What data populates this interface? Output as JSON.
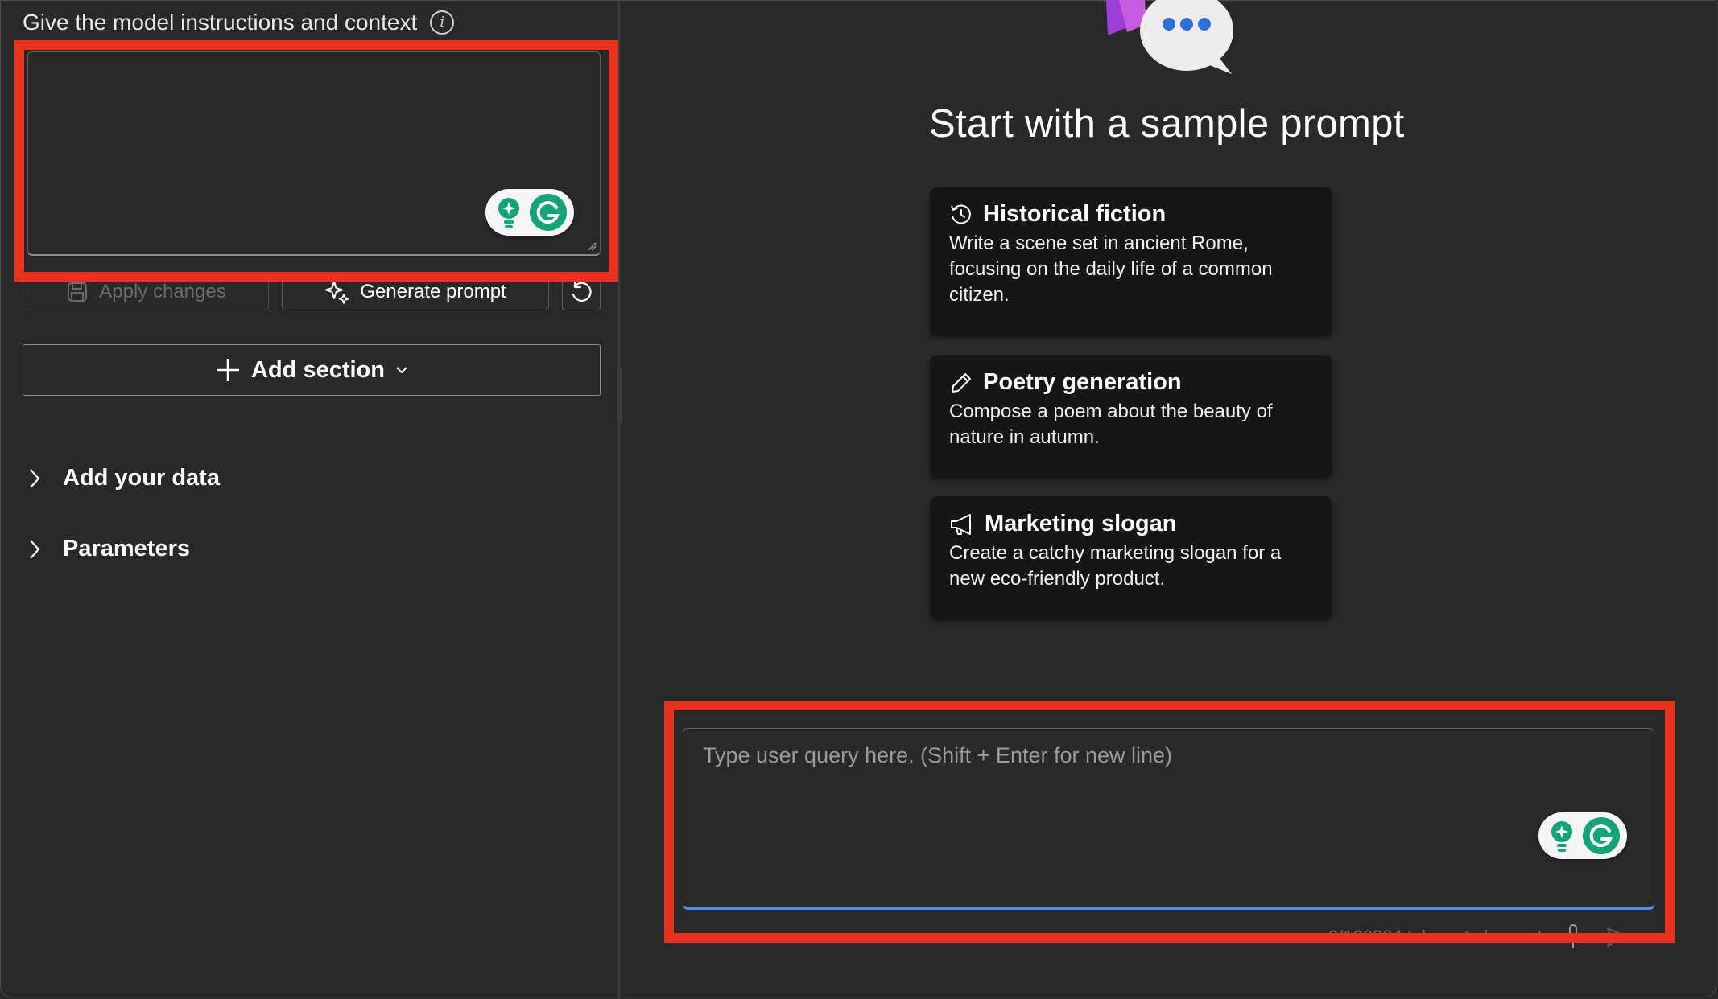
{
  "instructions": {
    "label": "Give the model instructions and context",
    "info_icon": "info-icon",
    "textarea_value": ""
  },
  "actions": {
    "apply_label": "Apply changes",
    "generate_label": "Generate prompt",
    "reset_icon": "undo-icon"
  },
  "add_section": {
    "label": "Add section"
  },
  "collapsibles": [
    {
      "label": "Add your data"
    },
    {
      "label": "Parameters"
    }
  ],
  "samples": {
    "heading": "Start with a sample prompt",
    "cards": [
      {
        "icon": "history-icon",
        "title": "Historical fiction",
        "desc": "Write a scene set in ancient Rome, focusing on the daily life of a common citizen."
      },
      {
        "icon": "pen-icon",
        "title": "Poetry generation",
        "desc": "Compose a poem about the beauty of nature in autumn."
      },
      {
        "icon": "megaphone-icon",
        "title": "Marketing slogan",
        "desc": "Create a catchy marketing slogan for a new eco-friendly product."
      }
    ]
  },
  "chat": {
    "placeholder": "Type user query here. (Shift + Enter for new line)",
    "token_count": "0/128384 tokens to be sent"
  },
  "colors": {
    "background": "#292929",
    "card": "#161616",
    "highlight": "#e8321e",
    "focus": "#4b8fe8",
    "grammarly": "#15a37a"
  }
}
